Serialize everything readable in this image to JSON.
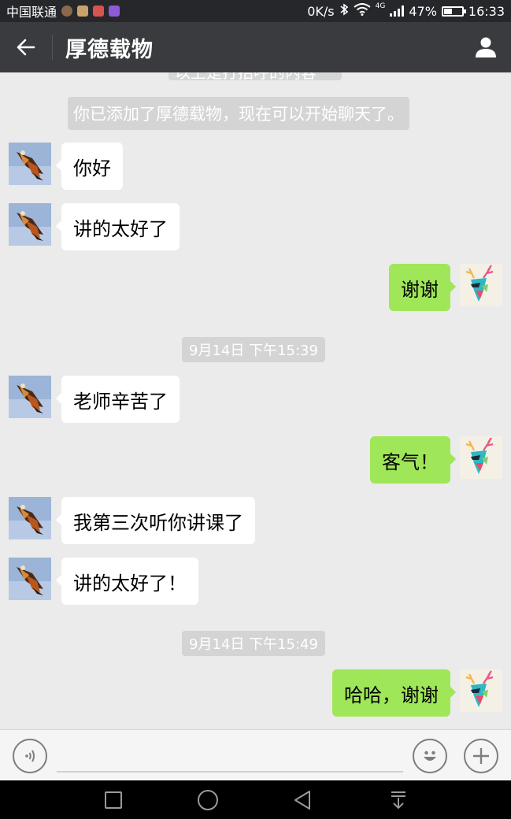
{
  "status_bar": {
    "carrier": "中国联通",
    "net_speed": "0K/s",
    "network_type": "4G",
    "battery": "47%",
    "battery_level": 0.47,
    "time": "16:33"
  },
  "header": {
    "title": "厚德载物"
  },
  "chat": {
    "cut_system_text": "以上是打招呼的内容",
    "system_message": "你已添加了厚德载物，现在可以开始聊天了。",
    "messages": [
      {
        "sender": "contact",
        "text": "你好"
      },
      {
        "sender": "contact",
        "text": "讲的太好了"
      },
      {
        "sender": "me",
        "text": "谢谢"
      },
      {
        "timestamp": "9月14日 下午15:39"
      },
      {
        "sender": "contact",
        "text": "老师辛苦了"
      },
      {
        "sender": "me",
        "text": "客气！"
      },
      {
        "sender": "contact",
        "text": "我第三次听你讲课了"
      },
      {
        "sender": "contact",
        "text": "讲的太好了！"
      },
      {
        "timestamp": "9月14日 下午15:49"
      },
      {
        "sender": "me",
        "text": "哈哈，谢谢"
      }
    ]
  },
  "input_bar": {
    "placeholder": "",
    "voice_icon": "voice-icon",
    "emoji_icon": "emoji-icon",
    "plus_icon": "plus-icon"
  },
  "colors": {
    "header_bg": "#3a3b3f",
    "chat_bg": "#ebebeb",
    "outgoing_bubble": "#9fe658",
    "incoming_bubble": "#ffffff"
  }
}
